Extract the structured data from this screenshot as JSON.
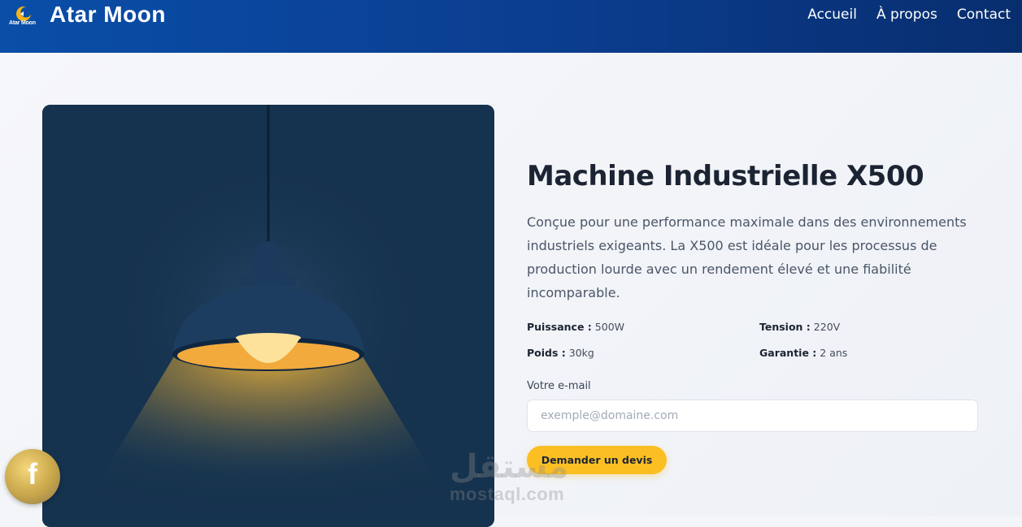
{
  "header": {
    "logo_text": "Atar Moon",
    "brand": "Atar Moon",
    "nav": [
      "Accueil",
      "À propos",
      "Contact"
    ]
  },
  "product": {
    "title": "Machine Industrielle X500",
    "description": "Conçue pour une performance maximale dans des environnements industriels exigeants. La X500 est idéale pour les processus de production lourde avec un rendement élevé et une fiabilité incomparable.",
    "specs": [
      {
        "label": "Puissance :",
        "value": "500W"
      },
      {
        "label": "Tension :",
        "value": "220V"
      },
      {
        "label": "Poids :",
        "value": "30kg"
      },
      {
        "label": "Garantie :",
        "value": "2 ans"
      }
    ]
  },
  "form": {
    "email_label": "Votre e-mail",
    "email_placeholder": "exemple@domaine.com",
    "submit_label": "Demander un devis"
  },
  "social": {
    "facebook_glyph": "f"
  },
  "watermark": {
    "arabic": "مستقل",
    "latin": "mostaql.com"
  },
  "colors": {
    "header": "#0b3d8f",
    "accent": "#fbbf24",
    "card": "#15324e",
    "title": "#1c2433"
  }
}
